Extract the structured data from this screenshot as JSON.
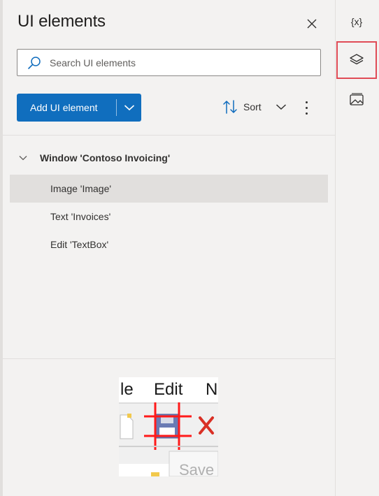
{
  "panel": {
    "title": "UI elements",
    "search": {
      "placeholder": "Search UI elements",
      "value": ""
    },
    "toolbar": {
      "add_label": "Add UI element",
      "sort_label": "Sort"
    },
    "tree": {
      "root_label": "Window 'Contoso Invoicing'",
      "items": [
        {
          "label": "Image 'Image'",
          "selected": true
        },
        {
          "label": "Text 'Invoices'",
          "selected": false
        },
        {
          "label": "Edit 'TextBox'",
          "selected": false
        }
      ]
    },
    "preview": {
      "menu_items": [
        "le",
        "Edit",
        "N"
      ],
      "tooltip_fragment": "Save"
    }
  },
  "rail": {
    "items": [
      {
        "icon": "variables-icon",
        "glyph": "{x}"
      },
      {
        "icon": "layers-icon",
        "active": true
      },
      {
        "icon": "images-icon"
      }
    ]
  },
  "colors": {
    "accent": "#106ebe",
    "highlight": "#e04b56",
    "selected_row": "#e1dfdd",
    "preview_marker": "#ff0000"
  }
}
